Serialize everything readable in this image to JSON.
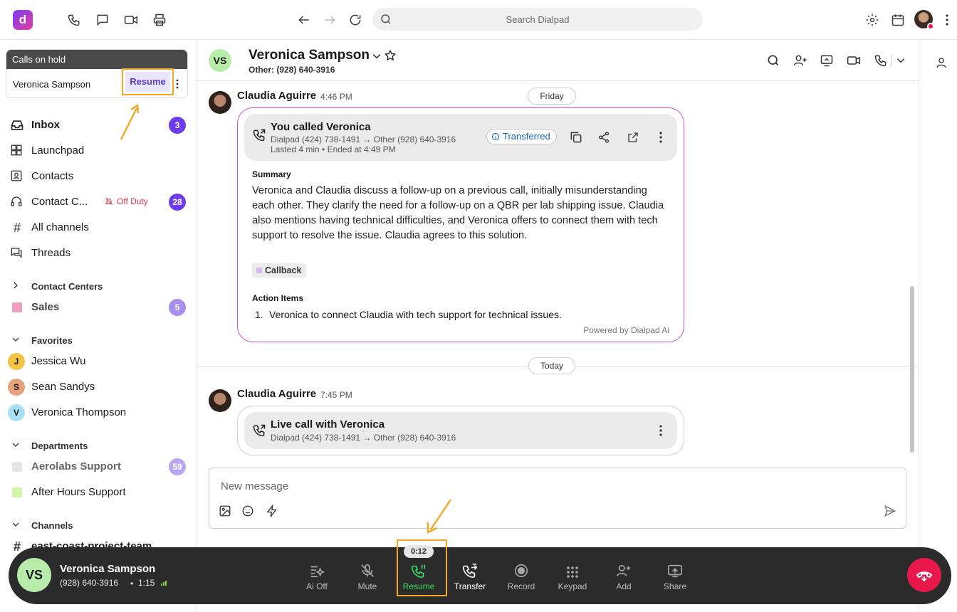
{
  "topbar": {
    "search_placeholder": "Search Dialpad"
  },
  "hold": {
    "header": "Calls on hold",
    "name": "Veronica Sampson",
    "resume": "Resume"
  },
  "nav": [
    {
      "label": "Inbox",
      "badge": "3"
    },
    {
      "label": "Launchpad"
    },
    {
      "label": "Contacts"
    },
    {
      "label": "Contact C...",
      "status": "Off Duty",
      "badge": "28"
    },
    {
      "label": "All channels"
    },
    {
      "label": "Threads"
    }
  ],
  "sections": {
    "contact_centers": "Contact Centers",
    "favorites": "Favorites",
    "departments": "Departments",
    "channels": "Channels"
  },
  "contact_centers": [
    {
      "label": "Sales",
      "badge": "5"
    }
  ],
  "favorites": [
    {
      "initial": "J",
      "name": "Jessica Wu"
    },
    {
      "initial": "S",
      "name": "Sean Sandys"
    },
    {
      "initial": "V",
      "name": "Veronica Thompson"
    }
  ],
  "departments": [
    {
      "label": "Aerolabs Support",
      "badge": "59"
    },
    {
      "label": "After Hours Support"
    }
  ],
  "channels": [
    {
      "label": "east-coast-project-team"
    }
  ],
  "chat": {
    "initials": "VS",
    "name": "Veronica Sampson",
    "sub": "Other: (928) 640-3916"
  },
  "messages": {
    "day1": "Friday",
    "day2": "Today",
    "m1": {
      "author": "Claudia Aguirre",
      "time": "4:46 PM",
      "title": "You called Veronica",
      "line1": "Dialpad (424) 738-1491 → Other (928) 640-3916",
      "line2": "Lasted 4 min • Ended at 4:49 PM",
      "status": "Transferred",
      "summary_label": "Summary",
      "summary": "Veronica and Claudia discuss a follow-up on a previous call, initially misunderstanding each other. They clarify the need for a follow-up on a QBR per lab shipping issue. Claudia also mentions having technical difficulties, and Veronica offers to connect them with tech support to resolve the issue. Claudia agrees to this solution.",
      "tag": "Callback",
      "action_label": "Action Items",
      "action_num": "1.",
      "action_1": "Veronica to connect Claudia with tech support for technical issues.",
      "powered": "Powered by Dialpad Ai"
    },
    "m2": {
      "author": "Claudia Aguirre",
      "time": "7:45 PM",
      "title": "Live call with Veronica",
      "line1": "Dialpad (424) 738-1491 → Other (928) 640-3916"
    }
  },
  "composer": {
    "placeholder": "New message"
  },
  "callbar": {
    "initials": "VS",
    "name": "Veronica Sampson",
    "number": "(928) 640-3916",
    "duration": "1:15",
    "timer": "0:12",
    "controls": [
      "Ai Off",
      "Mute",
      "Resume",
      "Transfer",
      "Record",
      "Keypad",
      "Add",
      "Share"
    ]
  },
  "colors": {
    "accent": "#5a3dd6",
    "highlight": "#f5a623",
    "resume_green": "#3ddc5a",
    "hangup": "#e8194a",
    "ai_border": "#d04fd2"
  }
}
